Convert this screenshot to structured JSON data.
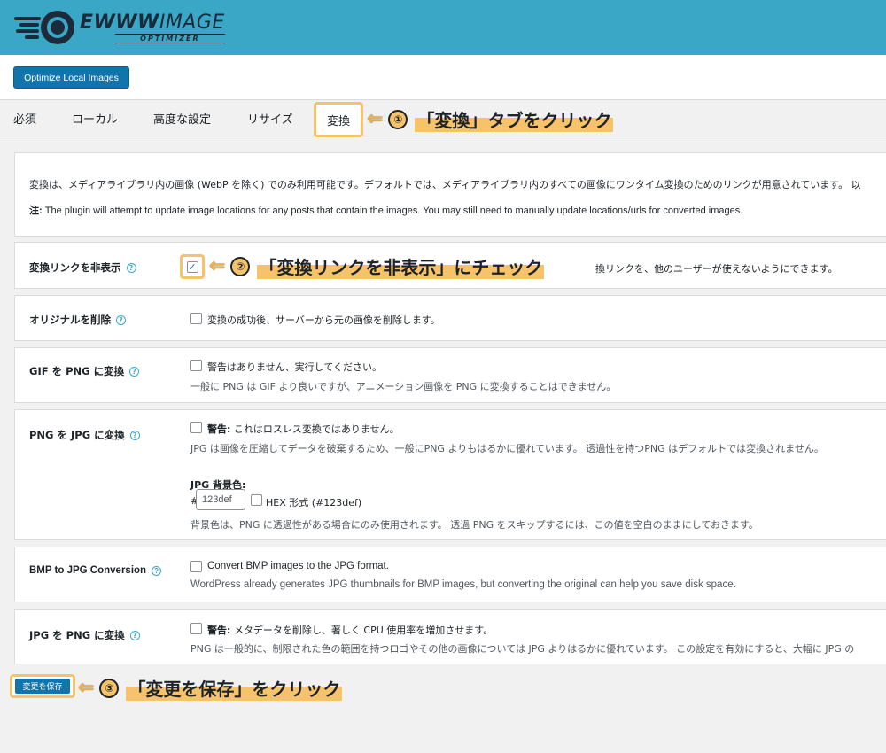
{
  "header": {
    "logo_main_1": "EWWW",
    "logo_main_2": "IMAGE",
    "logo_sub": "OPTIMIZER"
  },
  "topbar": {
    "optimize_label": "Optimize Local Images"
  },
  "tabs": {
    "items": [
      "必須",
      "ローカル",
      "高度な設定",
      "リサイズ"
    ],
    "active": "変換"
  },
  "annotations": {
    "a1": {
      "num": "①",
      "text": "「変換」タブをクリック"
    },
    "a2": {
      "num": "②",
      "text": "「変換リンクを非表示」にチェック"
    },
    "a3": {
      "num": "③",
      "text": "「変更を保存」をクリック"
    }
  },
  "intro": {
    "line1": "変換は、メディアライブラリ内の画像 (WebP を除く) でのみ利用可能です。デフォルトでは、メディアライブラリ内のすべての画像にワンタイム変換のためのリンクが用意されています。 以",
    "note_label": "注:",
    "note_text": " The plugin will attempt to update image locations for any posts that contain the images. You may still need to manually update locations/urls for converted images."
  },
  "rows": {
    "hide_links": {
      "label": "変換リンクを非表示",
      "text_partial": "換リンクを、他のユーザーが使えないようにできます。",
      "text_sep": "›"
    },
    "delete_original": {
      "label": "オリジナルを削除",
      "text": "変換の成功後、サーバーから元の画像を削除します。"
    },
    "gif_png": {
      "label": "GIF を PNG に変換",
      "text": "警告はありません、実行してください。",
      "desc": "一般に PNG は GIF より良いですが、アニメーション画像を PNG に変換することはできません。"
    },
    "png_jpg": {
      "label": "PNG を JPG に変換",
      "warn": "警告:",
      "text": " これはロスレス変換ではありません。",
      "desc": "JPG は画像を圧縮してデータを破棄するため、一般にPNG よりもはるかに優れています。 透過性を持つPNG はデフォルトでは変換されません。",
      "bg_label": "JPG 背景色:",
      "hash": "#",
      "bg_value": "123def",
      "hex_label": "HEX 形式 (#123def)",
      "bg_desc": "背景色は、PNG に透過性がある場合にのみ使用されます。 透過 PNG をスキップするには、この値を空白のままにしておきます。"
    },
    "bmp_jpg": {
      "label": "BMP to JPG Conversion",
      "text": "Convert BMP images to the JPG format.",
      "desc": "WordPress already generates JPG thumbnails for BMP images, but converting the original can help you save disk space."
    },
    "jpg_png": {
      "label": "JPG を PNG に変換",
      "warn": "警告:",
      "text": " メタデータを削除し、著しく CPU 使用率を増加させます。",
      "desc": "PNG は一般的に、制限された色の範囲を持つロゴやその他の画像については JPG よりはるかに優れています。 この設定を有効にすると、大幅に JPG の"
    }
  },
  "save": {
    "label": "変更を保存"
  },
  "help_glyph": "?",
  "check_glyph": "✓",
  "arrow_glyph": "⇐"
}
